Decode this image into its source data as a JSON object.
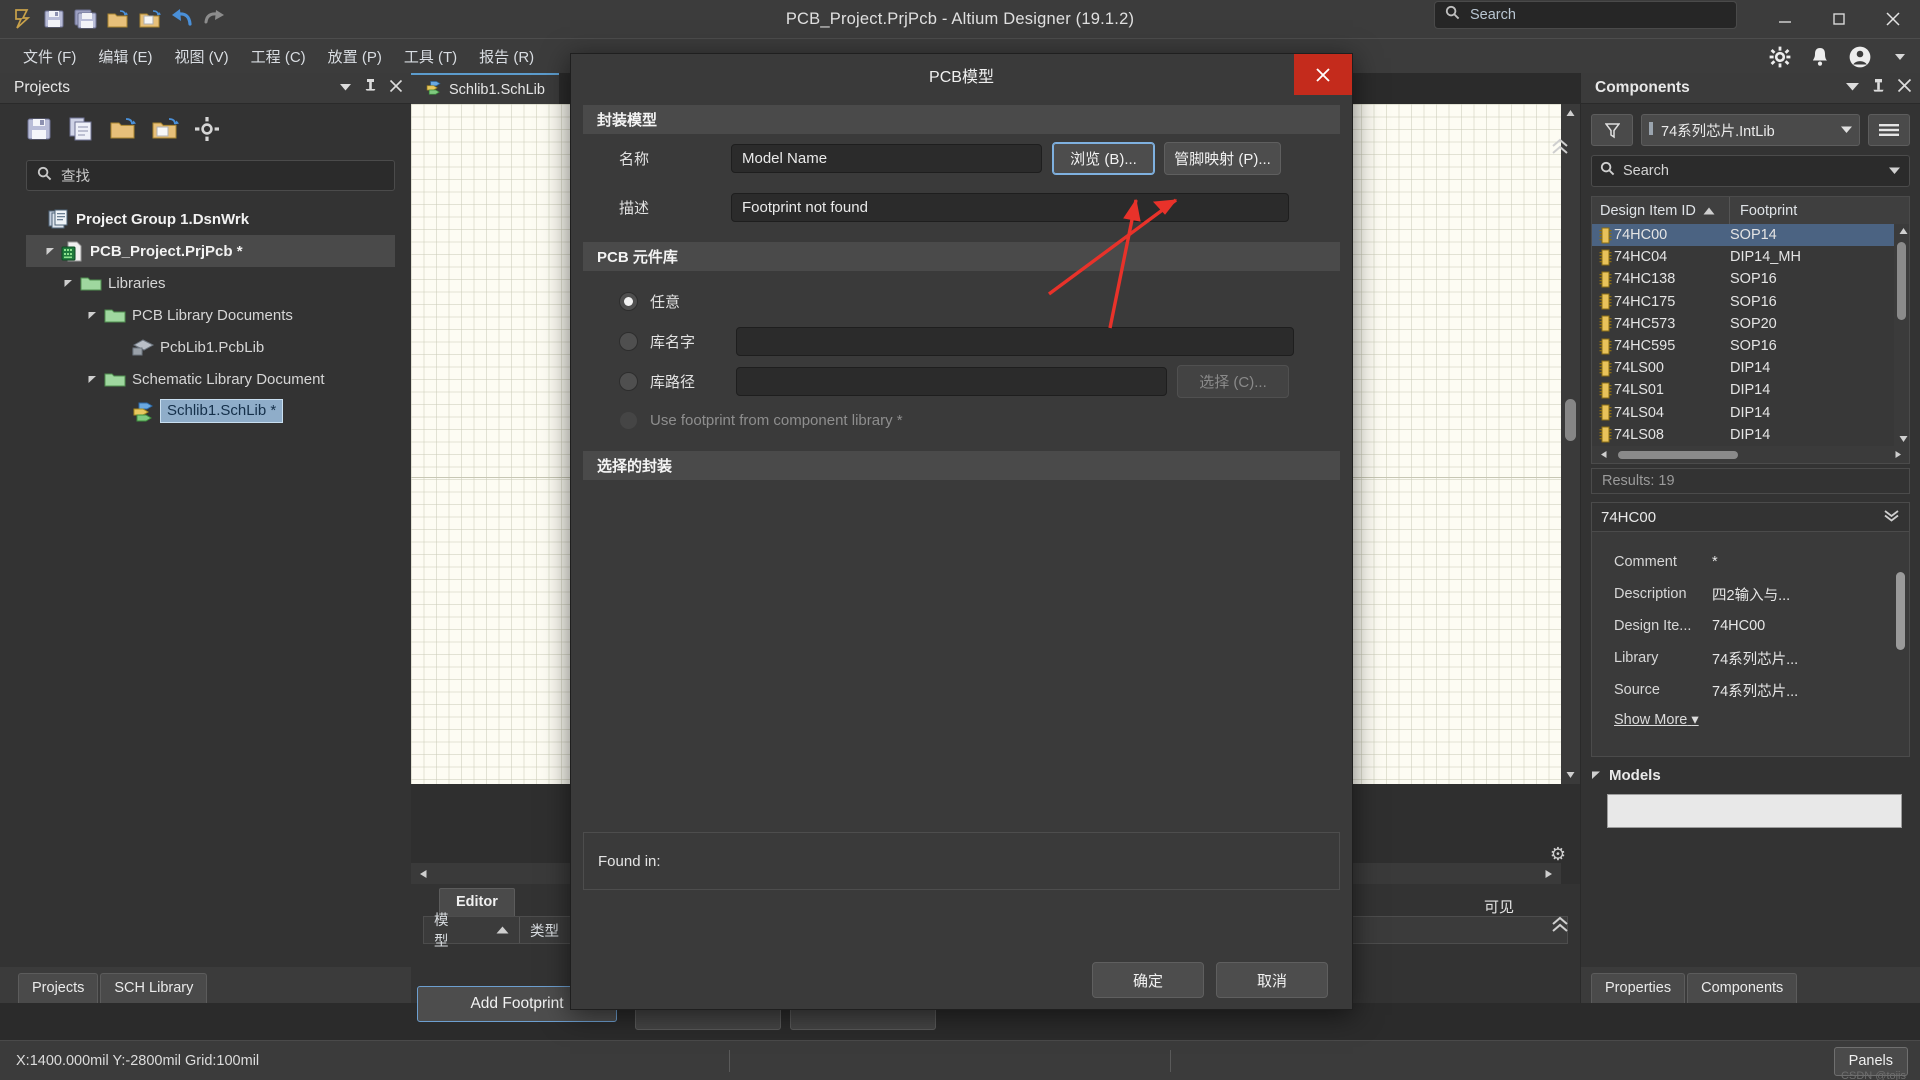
{
  "titlebar": {
    "title": "PCB_Project.PrjPcb - Altium Designer (19.1.2)",
    "search_placeholder": "Search",
    "quick_icons": [
      "altium-logo-icon",
      "save-icon",
      "save-all-icon",
      "open-project-icon",
      "open-document-icon",
      "undo-icon",
      "redo-icon"
    ],
    "window_buttons": [
      "minimize-icon",
      "maximize-icon",
      "close-icon"
    ]
  },
  "menubar": {
    "items": [
      {
        "label": "文件 (F)"
      },
      {
        "label": "编辑 (E)"
      },
      {
        "label": "视图 (V)"
      },
      {
        "label": "工程 (C)"
      },
      {
        "label": "放置 (P)"
      },
      {
        "label": "工具 (T)"
      },
      {
        "label": "报告 (R)"
      }
    ],
    "right_icons": [
      "gear-icon",
      "bell-icon",
      "account-icon",
      "chevron-down-icon"
    ]
  },
  "projects_panel": {
    "title": "Projects",
    "header_icons": [
      "chevron-down-icon",
      "pin-icon",
      "close-icon"
    ],
    "toolbar_icons": [
      "save-icon",
      "copy-icon",
      "open-folder-icon",
      "add-folder-icon",
      "gear-icon"
    ],
    "search_placeholder": "查找",
    "tree": [
      {
        "label": "Project Group 1.DsnWrk",
        "indent": 0,
        "icon": "workspace-icon",
        "arrow": "",
        "bold": true,
        "state": ""
      },
      {
        "label": "PCB_Project.PrjPcb *",
        "indent": 1,
        "icon": "pcb-project-icon",
        "arrow": "▼",
        "bold": true,
        "state": "sel-grey"
      },
      {
        "label": "Libraries",
        "indent": 2,
        "icon": "folder-icon",
        "arrow": "▼",
        "bold": false,
        "state": ""
      },
      {
        "label": "PCB Library Documents",
        "indent": 3,
        "icon": "folder-icon",
        "arrow": "▼",
        "bold": false,
        "state": ""
      },
      {
        "label": "PcbLib1.PcbLib",
        "indent": 4,
        "icon": "pcblib-icon",
        "arrow": "",
        "bold": false,
        "state": ""
      },
      {
        "label": "Schematic Library Document",
        "indent": 3,
        "icon": "folder-icon",
        "arrow": "▼",
        "bold": false,
        "state": ""
      },
      {
        "label": "Schlib1.SchLib *",
        "indent": 4,
        "icon": "schlib-icon",
        "arrow": "",
        "bold": false,
        "state": "sel-blue"
      }
    ],
    "tabs": [
      {
        "label": "Projects"
      },
      {
        "label": "SCH Library"
      }
    ]
  },
  "editor": {
    "document_tab": "Schlib1.SchLib",
    "document_tab_icon": "schlib-icon",
    "lower_tab": "Editor",
    "grid_headers": [
      {
        "label": "模型",
        "sort": "▲"
      },
      {
        "label": "类型"
      }
    ],
    "add_footprint_button": "Add Footprint",
    "partial_text": "可见"
  },
  "components_panel": {
    "title": "Components",
    "header_icons": [
      "chevron-down-icon",
      "pin-icon",
      "close-icon"
    ],
    "filter_icon": "funnel-icon",
    "menu_icon": "hamburger-icon",
    "library": "74系列芯片.IntLib",
    "search_placeholder": "Search",
    "search_icon": "search-icon",
    "columns": [
      "Design Item ID",
      "Footprint"
    ],
    "sort_indicator": "▲",
    "rows": [
      {
        "id": "74HC00",
        "footprint": "SOP14",
        "selected": true
      },
      {
        "id": "74HC04",
        "footprint": "DIP14_MH",
        "selected": false
      },
      {
        "id": "74HC138",
        "footprint": "SOP16",
        "selected": false
      },
      {
        "id": "74HC175",
        "footprint": "SOP16",
        "selected": false
      },
      {
        "id": "74HC573",
        "footprint": "SOP20",
        "selected": false
      },
      {
        "id": "74HC595",
        "footprint": "SOP16",
        "selected": false
      },
      {
        "id": "74LS00",
        "footprint": "DIP14",
        "selected": false
      },
      {
        "id": "74LS01",
        "footprint": "DIP14",
        "selected": false
      },
      {
        "id": "74LS04",
        "footprint": "DIP14",
        "selected": false
      },
      {
        "id": "74LS08",
        "footprint": "DIP14",
        "selected": false
      }
    ],
    "results": "Results: 19",
    "detail_title": "74HC00",
    "detail_rows": [
      {
        "key": "Comment",
        "value": "*"
      },
      {
        "key": "Description",
        "value": "四2输入与..."
      },
      {
        "key": "Design Ite...",
        "value": "74HC00"
      },
      {
        "key": "Library",
        "value": "74系列芯片..."
      },
      {
        "key": "Source",
        "value": "74系列芯片..."
      }
    ],
    "show_more": "Show More",
    "models_section": "Models",
    "tabs": [
      {
        "label": "Properties"
      },
      {
        "label": "Components"
      }
    ]
  },
  "dialog": {
    "title": "PCB模型",
    "close_icon": "close-icon",
    "groups": {
      "footprint_model": {
        "header": "封装模型",
        "name_label": "名称",
        "name_value": "Model Name",
        "browse_button": "浏览 (B)...",
        "pinmap_button": "管脚映射 (P)...",
        "desc_label": "描述",
        "desc_value": "Footprint not found"
      },
      "pcb_library": {
        "header": "PCB 元件库",
        "options": [
          {
            "label": "任意",
            "selected": true,
            "disabled": false,
            "has_input": false
          },
          {
            "label": "库名字",
            "selected": false,
            "disabled": false,
            "has_input": true,
            "input_value": ""
          },
          {
            "label": "库路径",
            "selected": false,
            "disabled": false,
            "has_input": true,
            "input_value": "",
            "button": "选择 (C)..."
          },
          {
            "label": "Use footprint from component library *",
            "selected": false,
            "disabled": true,
            "has_input": false
          }
        ]
      },
      "selected_footprint": {
        "header": "选择的封装"
      }
    },
    "found_in_label": "Found in:",
    "ok_button": "确定",
    "cancel_button": "取消"
  },
  "statusbar": {
    "coords": "X:1400.000mil Y:-2800mil    Grid:100mil",
    "panels_button": "Panels",
    "watermark": "CSDN @tojis"
  },
  "colors": {
    "accent_blue": "#6d9fd0",
    "close_red": "#c42b1c",
    "selection_blue": "#4b6382",
    "annotation_red": "#e8322a",
    "canvas": "#fdfcf3"
  }
}
